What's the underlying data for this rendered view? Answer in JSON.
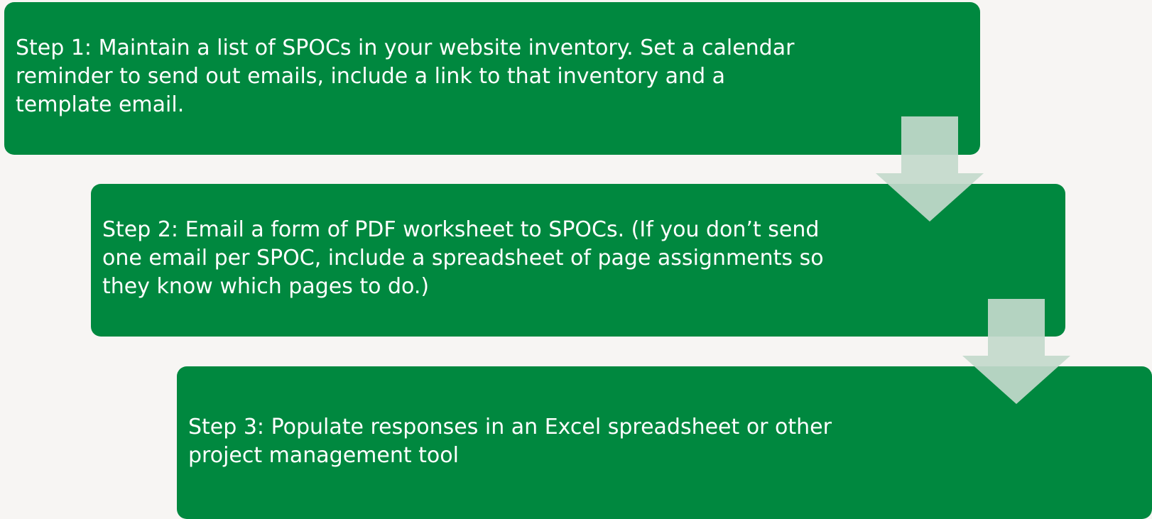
{
  "colors": {
    "background": "#f7f5f3",
    "step_fill": "#00883f",
    "step_text": "#ffffff",
    "arrow_fill": "#c3d9cc"
  },
  "steps": [
    {
      "text": "Step 1: Maintain a list of SPOCs in your website inventory. Set a calendar reminder to send out emails, include a link to that inventory and a template email."
    },
    {
      "text": "Step 2: Email a form of PDF worksheet to SPOCs. (If you don’t send one email per SPOC, include a spreadsheet of page assignments so they know which pages to do.)"
    },
    {
      "text": "Step 3: Populate responses in an Excel spreadsheet or other project management tool"
    }
  ],
  "connectors": [
    {
      "from": 1,
      "to": 2,
      "icon": "down-arrow-icon"
    },
    {
      "from": 2,
      "to": 3,
      "icon": "down-arrow-icon"
    }
  ]
}
